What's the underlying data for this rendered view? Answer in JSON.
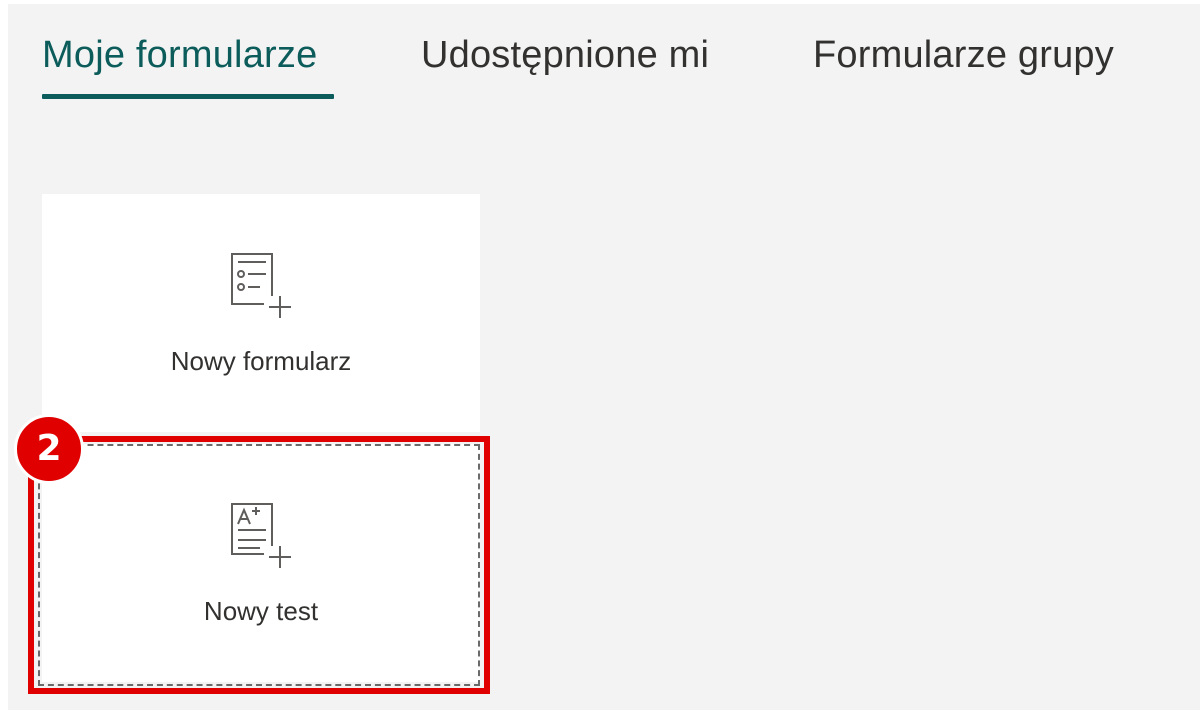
{
  "tabs": [
    {
      "label": "Moje formularze",
      "active": true
    },
    {
      "label": "Udostępnione mi",
      "active": false
    },
    {
      "label": "Formularze grupy",
      "active": false
    }
  ],
  "cards": {
    "new_form": {
      "label": "Nowy formularz",
      "icon": "new-form-icon"
    },
    "new_quiz": {
      "label": "Nowy test",
      "icon": "new-quiz-icon"
    }
  },
  "annotation": {
    "step_number": "2"
  },
  "colors": {
    "accent": "#0b5c5a",
    "highlight": "#e00000",
    "panel_bg": "#f3f3f3",
    "card_bg": "#ffffff"
  }
}
